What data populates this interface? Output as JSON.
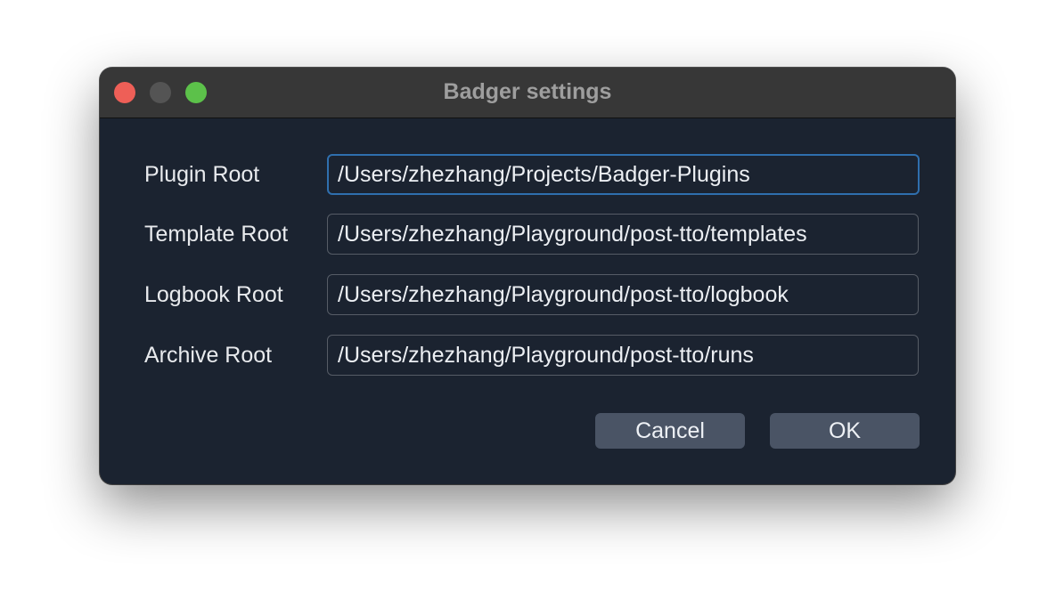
{
  "window": {
    "title": "Badger settings"
  },
  "settings": [
    {
      "label": "Plugin Root",
      "value": "/Users/zhezhang/Projects/Badger-Plugins"
    },
    {
      "label": "Template Root",
      "value": "/Users/zhezhang/Playground/post-tto/templates"
    },
    {
      "label": "Logbook Root",
      "value": "/Users/zhezhang/Playground/post-tto/logbook"
    },
    {
      "label": "Archive Root",
      "value": "/Users/zhezhang/Playground/post-tto/runs"
    }
  ],
  "buttons": {
    "cancel_label": "Cancel",
    "ok_label": "OK"
  },
  "colors": {
    "window_bg": "#1b2330",
    "titlebar_bg": "#373737",
    "button_bg": "#4a5465",
    "focus_border": "#2f6fae",
    "close": "#ee5f57",
    "minimize": "#545454",
    "maximize": "#5cc14a"
  },
  "icons": [
    "close-traffic-light-icon",
    "minimize-traffic-light-icon",
    "maximize-traffic-light-icon"
  ]
}
